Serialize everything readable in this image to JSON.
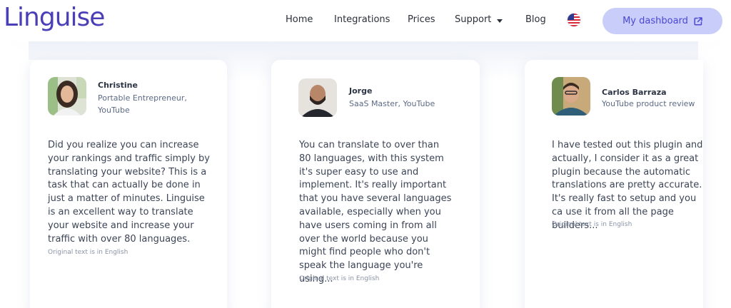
{
  "brand": {
    "logo": "Linguise"
  },
  "nav": {
    "items": [
      "Home",
      "Integrations",
      "Prices",
      "Support",
      "Blog"
    ],
    "language_flag": "us-flag-icon",
    "dashboard_label": "My dashboard"
  },
  "colors": {
    "brand": "#4b3fb8",
    "dashboard_bg": "#c9cdfa",
    "dashboard_text": "#4a47d2"
  },
  "testimonials": [
    {
      "name": "Christine",
      "role": "Portable Entrepreneur, YouTube",
      "quote": "Did you realize you can increase your rankings and traffic simply by translating your website? This is a task that can actually be done in just a matter of minutes. Linguise is an excellent way to translate your website and increase your traffic with over 80 languages.",
      "note": "Original text is in English"
    },
    {
      "name": "Jorge",
      "role": "SaaS Master, YouTube",
      "quote": "You can translate to over than 80 languages, with this system it's super easy to use and implement. It's really important that you have several languages available, especially when you have users coming in from all over the world because you might find people who don't speak the language you're using...",
      "note": "Original text is in English"
    },
    {
      "name": "Carlos Barraza",
      "role": "YouTube product review",
      "quote": "I have tested out this plugin and actually, I consider it as a great plugin because the automatic translations are pretty accurate. It's really fast to setup and you ca use it from all the page builders...",
      "note": "Original text is in English"
    }
  ]
}
